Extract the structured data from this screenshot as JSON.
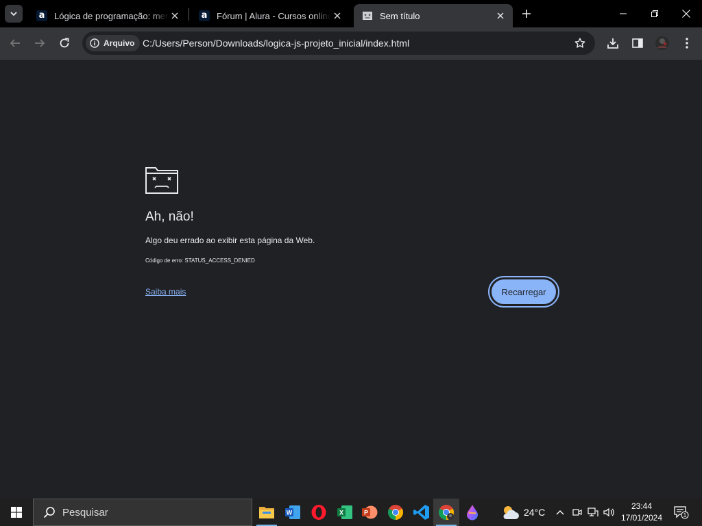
{
  "browser": {
    "tabs": [
      {
        "title": "Lógica de programação: mergulhe em programação com JavaScript",
        "favicon": "alura-logo-icon"
      },
      {
        "title": "Fórum | Alura - Cursos online de tecnologia",
        "favicon": "alura-logo-icon"
      },
      {
        "title": "Sem título",
        "favicon": "sad-page-icon",
        "active": true
      }
    ],
    "favicon_letter": "a",
    "address": {
      "chip_label": "Arquivo",
      "url": "C:/Users/Person/Downloads/logica-js-projeto_inicial/index.html"
    }
  },
  "error_page": {
    "title": "Ah, não!",
    "message": "Algo deu errado ao exibir esta página da Web.",
    "code_line": "Código de erro: STATUS_ACCESS_DENIED",
    "learn_more": "Saiba mais",
    "reload_label": "Recarregar"
  },
  "taskbar": {
    "search_placeholder": "Pesquisar",
    "apps": [
      "file-explorer-icon",
      "word-icon",
      "opera-icon",
      "excel-icon",
      "powerpoint-icon",
      "chrome-icon",
      "vscode-icon",
      "chrome-profile-icon",
      "paint-drop-icon"
    ],
    "word_letter": "W",
    "excel_letter": "X",
    "powerpoint_letter": "P",
    "weather_temp": "24°C",
    "time": "23:44",
    "date": "17/01/2024",
    "notification_count": "1"
  },
  "colors": {
    "accent": "#8ab4f8",
    "page_bg": "#202124",
    "toolbar_bg": "#35363a"
  }
}
